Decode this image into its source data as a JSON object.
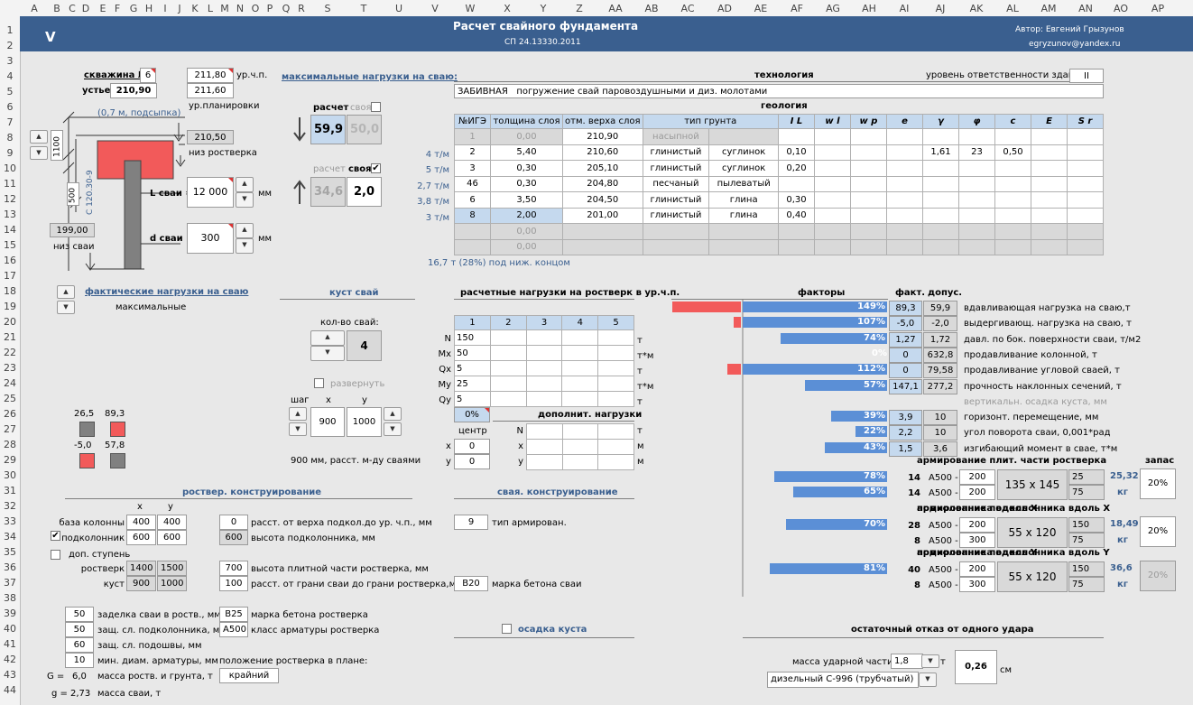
{
  "cols": [
    "A",
    "B",
    "C",
    "D",
    "E",
    "F",
    "G",
    "H",
    "I",
    "J",
    "K",
    "L",
    "M",
    "N",
    "O",
    "P",
    "Q",
    "R",
    "S",
    "T",
    "U",
    "V",
    "W",
    "X",
    "Y",
    "Z",
    "AA",
    "AB",
    "AC",
    "AD",
    "AE",
    "AF",
    "AG",
    "AH",
    "AI",
    "AJ",
    "AK",
    "AL",
    "AM",
    "AN",
    "AO",
    "AP"
  ],
  "rows": [
    "1",
    "2",
    "3",
    "4",
    "5",
    "6",
    "7",
    "8",
    "9",
    "10",
    "11",
    "12",
    "13",
    "14",
    "15",
    "16",
    "17",
    "18",
    "19",
    "20",
    "21",
    "22",
    "23",
    "24",
    "25",
    "26",
    "27",
    "28",
    "29",
    "30",
    "31",
    "32",
    "33",
    "34",
    "35",
    "36",
    "37",
    "38",
    "39",
    "40",
    "41",
    "42",
    "43",
    "44"
  ],
  "banner": {
    "logo": "V",
    "title": "Расчет свайного фундамента",
    "subtitle": "СП 24.13330.2011",
    "author": "Автор: Евгений Грызунов",
    "email": "egryzunov@yandex.ru"
  },
  "well": {
    "label": "скважина №",
    "num": "6",
    "ustye_label": "устье:",
    "ustye": "210,90",
    "ground": "211,80",
    "ground_label": "ур.ч.п.",
    "plan": "211,60",
    "plan_label": "ур.планировки",
    "fill_note": "(0,7 м, подсыпка)",
    "bottom": "210,50",
    "bottom_label": "низ ростверка",
    "dim1": "1100",
    "dim2": "500",
    "pile_bottom": "199,00",
    "pile_bottom_label": "низ сваи",
    "pile_mark": "С 120.30-9",
    "L_label": "L сваи =",
    "L": "12 000",
    "d_label": "d сваи =",
    "d": "300",
    "mm": "мм"
  },
  "loads": {
    "title": "максимальные нагрузки на сваю:",
    "calc": "расчет",
    "own": "своя",
    "comp_calc": "59,9",
    "comp_own": "50,0",
    "tens_calc": "34,6",
    "tens_own": "2,0"
  },
  "tech": {
    "title": "технология",
    "resp_label": "уровень ответственности здания:",
    "resp": "II",
    "method": "ЗАБИВНАЯ",
    "method_desc": "погружение свай паровоздушными и диз. молотами"
  },
  "geo": {
    "title": "геология",
    "headers": [
      "№ИГЭ",
      "толщина слоя",
      "отм. верха слоя",
      "тип грунта",
      "",
      "I L",
      "w l",
      "w p",
      "e",
      "γ",
      "φ",
      "c",
      "E",
      "S r"
    ],
    "rows": [
      {
        "side": "",
        "ige": "1",
        "h": "0,00",
        "top": "210,90",
        "type": "насыпной",
        "sub": "",
        "il": "",
        "wl": "",
        "wp": "",
        "e": "",
        "g": "",
        "f": "",
        "c": "",
        "E": "",
        "S": ""
      },
      {
        "side": "4 т/м",
        "ige": "2",
        "h": "5,40",
        "top": "210,60",
        "type": "глинистый",
        "sub": "суглинок",
        "il": "0,10",
        "wl": "",
        "wp": "",
        "e": "",
        "g": "1,61",
        "f": "23",
        "c": "0,50",
        "E": "",
        "S": ""
      },
      {
        "side": "5 т/м",
        "ige": "3",
        "h": "0,30",
        "top": "205,10",
        "type": "глинистый",
        "sub": "суглинок",
        "il": "0,20",
        "wl": "",
        "wp": "",
        "e": "",
        "g": "",
        "f": "",
        "c": "",
        "E": "",
        "S": ""
      },
      {
        "side": "2,7 т/м",
        "ige": "46",
        "h": "0,30",
        "top": "204,80",
        "type": "песчаный",
        "sub": "пылеватый",
        "il": "",
        "wl": "",
        "wp": "",
        "e": "",
        "g": "",
        "f": "",
        "c": "",
        "E": "",
        "S": ""
      },
      {
        "side": "3,8 т/м",
        "ige": "6",
        "h": "3,50",
        "top": "204,50",
        "type": "глинистый",
        "sub": "глина",
        "il": "0,30",
        "wl": "",
        "wp": "",
        "e": "",
        "g": "",
        "f": "",
        "c": "",
        "E": "",
        "S": ""
      },
      {
        "side": "3 т/м",
        "ige": "8",
        "h": "2,00",
        "top": "201,00",
        "type": "глинистый",
        "sub": "глина",
        "il": "0,40",
        "wl": "",
        "wp": "",
        "e": "",
        "g": "",
        "f": "",
        "c": "",
        "E": "",
        "S": ""
      },
      {
        "side": "",
        "ige": "",
        "h": "0,00",
        "top": "",
        "type": "",
        "sub": "",
        "il": "",
        "wl": "",
        "wp": "",
        "e": "",
        "g": "",
        "f": "",
        "c": "",
        "E": "",
        "S": ""
      },
      {
        "side": "",
        "ige": "",
        "h": "0,00",
        "top": "",
        "type": "",
        "sub": "",
        "il": "",
        "wl": "",
        "wp": "",
        "e": "",
        "g": "",
        "f": "",
        "c": "",
        "E": "",
        "S": ""
      }
    ],
    "note": "16,7 т (28%) под ниж. концом"
  },
  "actual": {
    "title": "фактические нагрузки на сваю",
    "mode": "максимальные",
    "v1": "26,5",
    "v2": "89,3",
    "v3": "-5,0",
    "v4": "57,8"
  },
  "bush": {
    "title": "куст свай",
    "count_label": "кол-во свай:",
    "count": "4",
    "rotate": "развернуть",
    "step": "шаг",
    "x": "x",
    "y": "y",
    "sx": "900",
    "sy": "1000",
    "dist": "900 мм, расст. м-ду сваями"
  },
  "rl": {
    "title": "расчетные нагрузки на ростверк в ур.ч.п.",
    "cols": [
      "1",
      "2",
      "3",
      "4",
      "5"
    ],
    "rows": [
      {
        "k": "N",
        "v": "150",
        "u": "т"
      },
      {
        "k": "Mx",
        "v": "50",
        "u": "т*м"
      },
      {
        "k": "Qx",
        "v": "5",
        "u": "т"
      },
      {
        "k": "My",
        "v": "25",
        "u": "т*м"
      },
      {
        "k": "Qy",
        "v": "5",
        "u": "т"
      }
    ],
    "pct": "0%",
    "extra": "дополнит. нагрузки",
    "center": "центр",
    "cx": "0",
    "cy": "0",
    "ex": [
      {
        "k": "N",
        "u": "т"
      },
      {
        "k": "x",
        "u": "м"
      },
      {
        "k": "y",
        "u": "м"
      }
    ]
  },
  "factors": {
    "title": "факторы",
    "fact": "факт.",
    "allow": "допус.",
    "rows": [
      {
        "pct": "149%",
        "v": 1.49,
        "neg": 1,
        "f": "89,3",
        "a": "59,9",
        "label": "вдавливающая нагрузка на сваю,т"
      },
      {
        "pct": "107%",
        "v": 1.07,
        "neg": 0.1,
        "f": "-5,0",
        "a": "-2,0",
        "label": "выдергивающ. нагрузка на сваю, т"
      },
      {
        "pct": "74%",
        "v": 0.74,
        "neg": 0,
        "f": "1,27",
        "a": "1,72",
        "label": "давл. по бок. поверхности сваи, т/м2"
      },
      {
        "pct": "0%",
        "v": 0,
        "neg": 0,
        "f": "0",
        "a": "632,8",
        "label": "продавливание колонной, т"
      },
      {
        "pct": "112%",
        "v": 1.12,
        "neg": 0.2,
        "f": "0",
        "a": "79,58",
        "label": "продавливание угловой сваей, т"
      },
      {
        "pct": "57%",
        "v": 0.57,
        "neg": 0,
        "f": "147,1",
        "a": "277,2",
        "label": "прочность наклонных сечений, т"
      },
      {
        "pct": "",
        "v": 0,
        "neg": 0,
        "f": "",
        "a": "",
        "label": "вертикальн. осадка куста, мм"
      },
      {
        "pct": "39%",
        "v": 0.39,
        "neg": 0,
        "f": "3,9",
        "a": "10",
        "label": "горизонт. перемещение, мм"
      },
      {
        "pct": "22%",
        "v": 0.22,
        "neg": 0,
        "f": "2,2",
        "a": "10",
        "label": "угол поворота сваи, 0,001*рад"
      },
      {
        "pct": "43%",
        "v": 0.43,
        "neg": 0,
        "f": "1,5",
        "a": "3,6",
        "label": "изгибающий момент в свае, т*м"
      }
    ]
  },
  "arm": {
    "reserve": "запас",
    "kg": "кг",
    "plate": "армирование плит. части ростверка",
    "px": "подколонника вдоль X",
    "py": "подколонника вдоль Y",
    "prefix": "армирование",
    "b1": {
      "r1": {
        "pct": "78%",
        "v": 0.78,
        "d": "14",
        "cls": "A500 -",
        "s": "200"
      },
      "r2": {
        "pct": "65%",
        "v": 0.65,
        "d": "14",
        "cls": "A500 -",
        "s": "200"
      },
      "dim": "135 x 145",
      "c1": "25",
      "c2": "75",
      "mass": "25,32",
      "res": "20%"
    },
    "b2": {
      "r1": {
        "pct": "70%",
        "v": 0.7,
        "d": "28",
        "cls": "A500 -",
        "s": "200"
      },
      "r2": {
        "pct": "",
        "v": 0,
        "d": "8",
        "cls": "A500 -",
        "s": "300"
      },
      "dim": "55 x 120",
      "c1": "150",
      "c2": "75",
      "mass": "18,49",
      "res": "20%"
    },
    "b3": {
      "r1": {
        "pct": "81%",
        "v": 0.81,
        "d": "40",
        "cls": "A500 -",
        "s": "200"
      },
      "r2": {
        "pct": "",
        "v": 0,
        "d": "8",
        "cls": "A500 -",
        "s": "300"
      },
      "dim": "55 x 120",
      "c1": "150",
      "c2": "75",
      "mass": "36,6",
      "res": "20%"
    }
  },
  "constr": {
    "title": "роствер. конструирование",
    "x": "x",
    "y": "y",
    "base_label": "база колонны",
    "base_x": "400",
    "base_y": "400",
    "sub_label": "подколонник",
    "sub_x": "600",
    "sub_y": "600",
    "extra_step": "доп. ступень",
    "grill_label": "ростверк",
    "grill_x": "1400",
    "grill_y": "1500",
    "bush_label": "куст",
    "bush_x": "900",
    "bush_y": "1000",
    "p1": "0",
    "p1_label": "расст. от верха подкол.до ур. ч.п., мм",
    "p2": "600",
    "p2_label": "высота подколонника, мм",
    "p3": "700",
    "p3_label": "высота плитной части ростверка, мм",
    "p4": "100",
    "p4_label": "расст. от грани сваи до грани ростверка,мм",
    "q1": "50",
    "q1_label": "заделка сваи в роств., мм",
    "q2": "50",
    "q2_label": "защ. сл. подколонника, мм",
    "q3": "60",
    "q3_label": "защ. сл. подошвы, мм",
    "q4": "10",
    "q4_label": "мин. диам. арматуры, мм",
    "concrete": "B25",
    "concrete_label": "марка бетона ростверка",
    "steel": "A500",
    "steel_label": "класс арматуры ростверка",
    "pos_label": "положение ростверка в плане:",
    "pos": "крайний",
    "G_label": "G =",
    "G": "6,0",
    "G_desc": "масса роств. и грунта, т",
    "g_label": "g =",
    "g": "2,73",
    "g_desc": "масса сваи, т"
  },
  "pileconstr": {
    "title": "свая. конструирование",
    "arm": "9",
    "arm_label": "тип армирован.",
    "concrete": "B20",
    "concrete_label": "марка бетона сваи",
    "settle": "осадка куста"
  },
  "refusal": {
    "title": "остаточный отказ от одного удара",
    "mass_label": "масса ударной части:",
    "mass": "1,8",
    "t": "т",
    "result": "0,26",
    "cm": "см",
    "hammer": "дизельный С-996 (трубчатый)"
  }
}
